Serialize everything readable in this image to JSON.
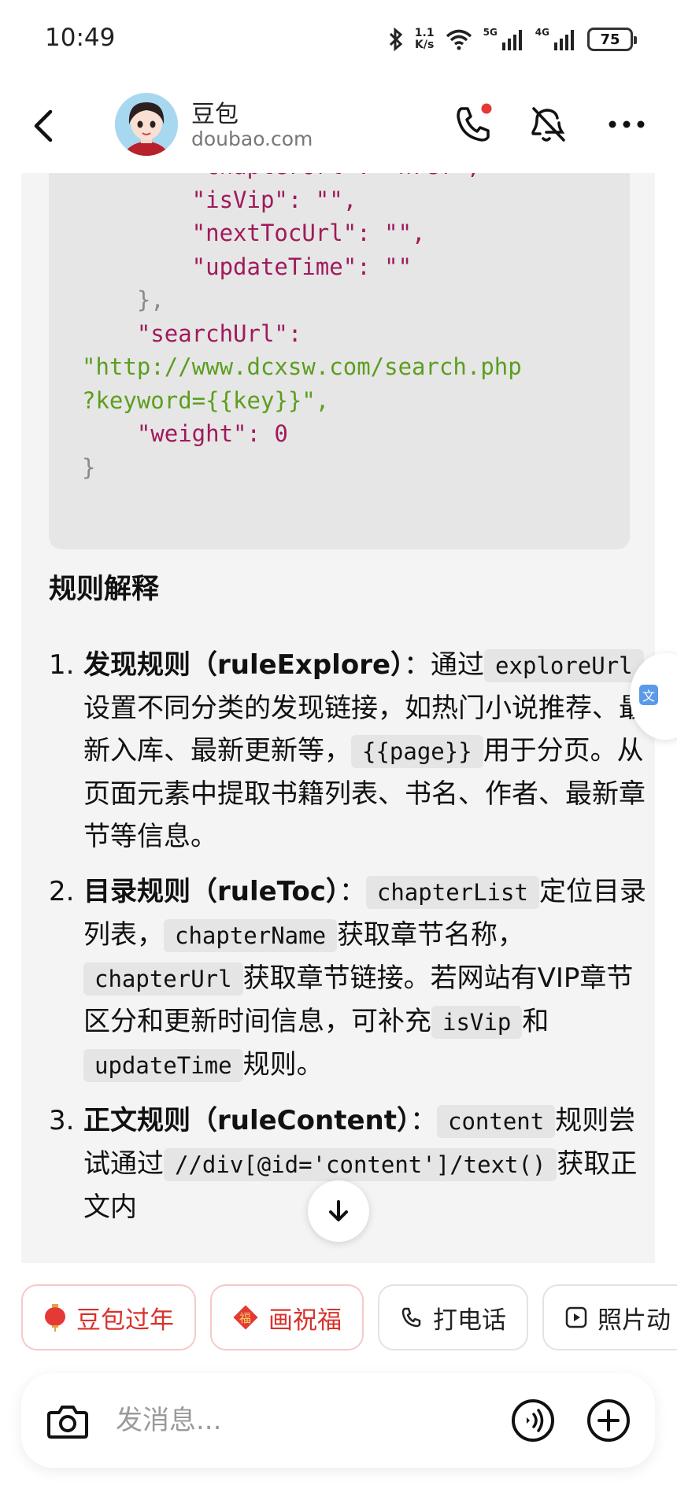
{
  "status_bar": {
    "time": "10:49",
    "net_speed_value": "1.1",
    "net_speed_unit": "K/s",
    "signal_1": "5G",
    "signal_2": "4G",
    "battery": "75",
    "icons": [
      "bluetooth-icon",
      "wifi-icon",
      "signal-5g-icon",
      "signal-4g-icon",
      "battery-icon"
    ]
  },
  "header": {
    "name": "豆包",
    "domain": "doubao.com",
    "icons": [
      "back-icon",
      "avatar",
      "phone-icon",
      "mute-icon",
      "more-icon"
    ],
    "accent_color": "#e53935"
  },
  "code_lines": [
    "        \"chapterUrl\": \"href\",",
    "        \"isVip\": \"\",",
    "        \"nextTocUrl\": \"\",",
    "        \"updateTime\": \"\"",
    "    },",
    "    \"searchUrl\":",
    "\"http://www.dcxsw.com/search.php",
    "?keyword={{key}}\",",
    "    \"weight\": 0",
    "}"
  ],
  "section_title": "规则解释",
  "rules": [
    {
      "num": "1.",
      "title": "发现规则（ruleExplore）",
      "t1": "：通过",
      "c1": "exploreUrl",
      "t2": "设置不同分类的发现链接，如热门小说推荐、最新入库、最新更新等，",
      "c2": "{{page}}",
      "t3": "用于分页。从页面元素中提取书籍列表、书名、作者、最新章节等信息。"
    },
    {
      "num": "2.",
      "title": "目录规则（ruleToc）",
      "t1": "：",
      "c1": "chapterList",
      "t2": "定位目录列表，",
      "c2": "chapterName",
      "t3": "获取章节名称，",
      "c3": "chapterUrl",
      "t4": "获取章节链接。若网站有VIP章节区分和更新时间信息，可补充",
      "c4": "isVip",
      "t5": "和",
      "c5": "updateTime",
      "t6": "规则。"
    },
    {
      "num": "3.",
      "title": "正文规则（ruleContent）",
      "t1": "：",
      "c1": "content",
      "t2": "规则尝试通过",
      "c2": "//div[@id='content']/text()",
      "t3": "获取正文内"
    }
  ],
  "chips": [
    {
      "label": "豆包过年",
      "icon": "lantern-icon"
    },
    {
      "label": "画祝福",
      "icon": "fu-icon"
    },
    {
      "label": "打电话",
      "icon": "phone-icon"
    },
    {
      "label": "照片动",
      "icon": "play-icon"
    }
  ],
  "input": {
    "placeholder": "发消息..."
  }
}
